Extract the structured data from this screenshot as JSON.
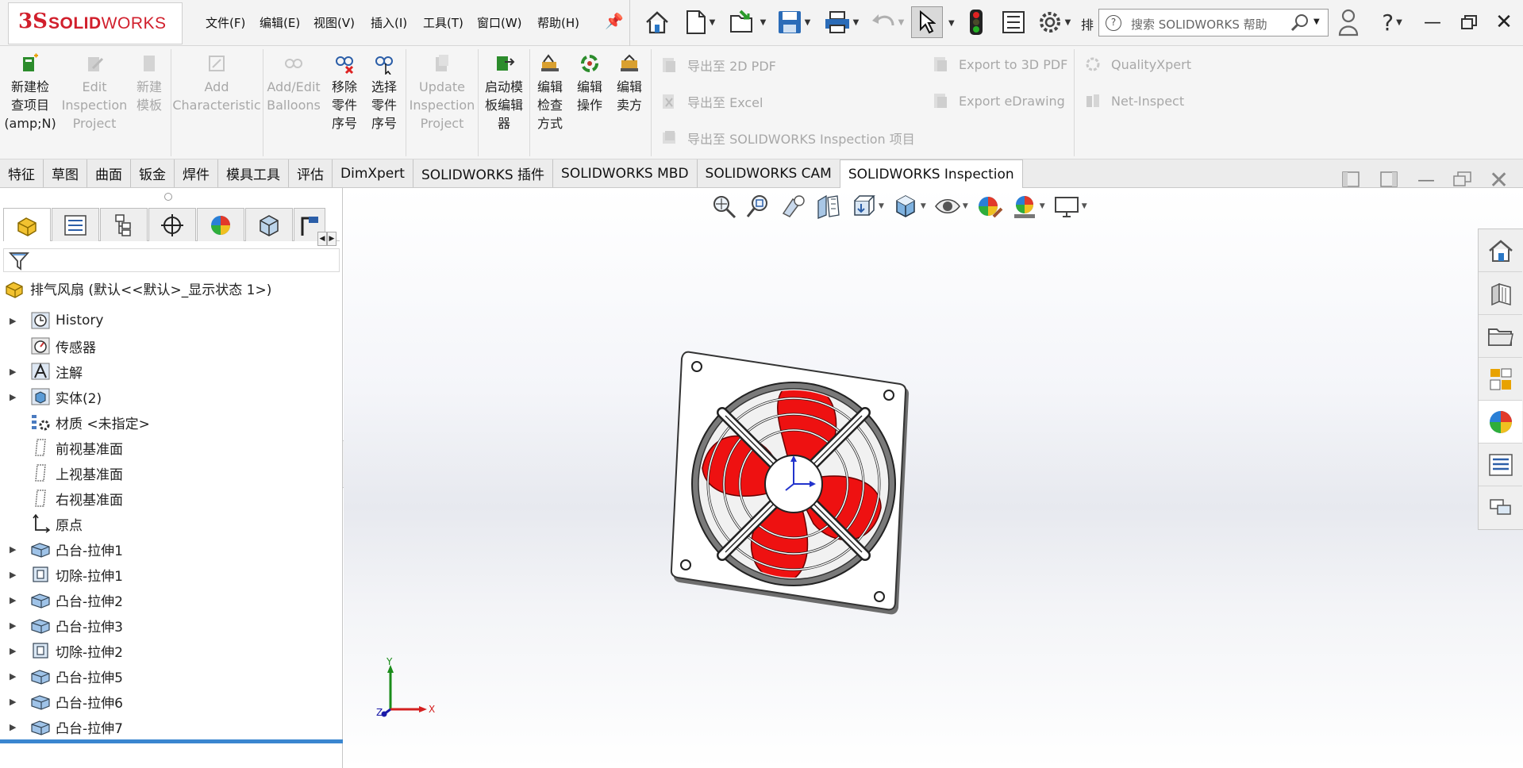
{
  "app": {
    "logo_mark": "3S",
    "logo_name_bold": "SOLID",
    "logo_name_light": "WORKS",
    "brand_color": "#d11f2c"
  },
  "menu": [
    "文件(F)",
    "编辑(E)",
    "视图(V)",
    "插入(I)",
    "工具(T)",
    "窗口(W)",
    "帮助(H)"
  ],
  "toolbar": {
    "overflow_label": "排",
    "search_placeholder": "搜索 SOLIDWORKS 帮助"
  },
  "ribbon": {
    "buttons": [
      {
        "label": "新建检\n查项目\n(amp;N)",
        "enabled": true
      },
      {
        "label": "Edit\nInspection\nProject",
        "enabled": false
      },
      {
        "label": "新建\n模板",
        "enabled": false
      },
      {
        "label": "Add\nCharacteristic",
        "enabled": false
      },
      {
        "label": "Add/Edit\nBalloons",
        "enabled": false
      },
      {
        "label": "移除\n零件\n序号",
        "enabled": true
      },
      {
        "label": "选择\n零件\n序号",
        "enabled": true
      },
      {
        "label": "Update\nInspection\nProject",
        "enabled": false
      },
      {
        "label": "启动模\n板编辑\n器",
        "enabled": true
      },
      {
        "label": "编辑\n检查\n方式",
        "enabled": true
      },
      {
        "label": "编辑\n操作",
        "enabled": true
      },
      {
        "label": "编辑\n卖方",
        "enabled": true
      }
    ],
    "export_col1": [
      "导出至 2D PDF",
      "导出至 Excel",
      "导出至 SOLIDWORKS Inspection 项目"
    ],
    "export_col2": [
      "Export to 3D PDF",
      "Export eDrawing"
    ],
    "export_col3": [
      "QualityXpert",
      "Net-Inspect"
    ]
  },
  "tabs": [
    "特征",
    "草图",
    "曲面",
    "钣金",
    "焊件",
    "模具工具",
    "评估",
    "DimXpert",
    "SOLIDWORKS 插件",
    "SOLIDWORKS MBD",
    "SOLIDWORKS CAM",
    "SOLIDWORKS Inspection"
  ],
  "active_tab": "SOLIDWORKS Inspection",
  "tree": {
    "root": "排气风扇 (默认<<默认>_显示状态 1>)",
    "items": [
      {
        "label": "History",
        "expandable": true,
        "icon": "history-icon"
      },
      {
        "label": "传感器",
        "expandable": false,
        "icon": "sensor-icon"
      },
      {
        "label": "注解",
        "expandable": true,
        "icon": "annotation-icon"
      },
      {
        "label": "实体(2)",
        "expandable": true,
        "icon": "solid-body-icon"
      },
      {
        "label": "材质 <未指定>",
        "expandable": false,
        "icon": "material-icon"
      },
      {
        "label": "前视基准面",
        "expandable": false,
        "icon": "plane-icon"
      },
      {
        "label": "上视基准面",
        "expandable": false,
        "icon": "plane-icon"
      },
      {
        "label": "右视基准面",
        "expandable": false,
        "icon": "plane-icon"
      },
      {
        "label": "原点",
        "expandable": false,
        "icon": "origin-icon"
      },
      {
        "label": "凸台-拉伸1",
        "expandable": true,
        "icon": "boss-extrude-icon"
      },
      {
        "label": "切除-拉伸1",
        "expandable": true,
        "icon": "cut-extrude-icon"
      },
      {
        "label": "凸台-拉伸2",
        "expandable": true,
        "icon": "boss-extrude-icon"
      },
      {
        "label": "凸台-拉伸3",
        "expandable": true,
        "icon": "boss-extrude-icon"
      },
      {
        "label": "切除-拉伸2",
        "expandable": true,
        "icon": "cut-extrude-icon"
      },
      {
        "label": "凸台-拉伸5",
        "expandable": true,
        "icon": "boss-extrude-icon"
      },
      {
        "label": "凸台-拉伸6",
        "expandable": true,
        "icon": "boss-extrude-icon"
      },
      {
        "label": "凸台-拉伸7",
        "expandable": true,
        "icon": "boss-extrude-icon"
      }
    ]
  },
  "triad": {
    "x_label": "X",
    "y_label": "Y",
    "z_label": "Z"
  }
}
